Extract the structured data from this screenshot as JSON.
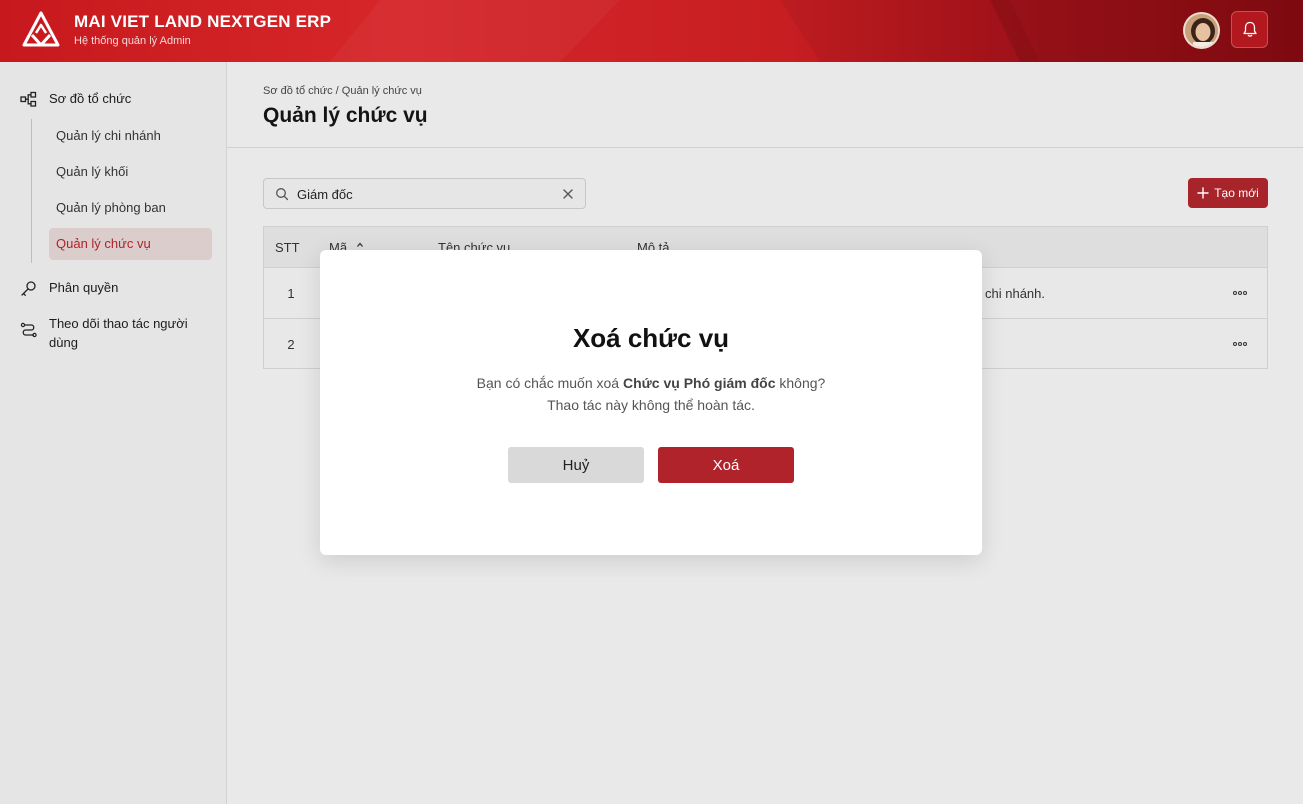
{
  "app": {
    "title": "MAI VIET LAND NEXTGEN ERP",
    "subtitle": "Hệ thống quản lý Admin"
  },
  "header": {
    "avatar_icon": "user-avatar",
    "notification_icon": "bell-icon"
  },
  "sidebar": {
    "groups": [
      {
        "label": "Sơ đồ tổ chức",
        "icon": "org-chart-icon"
      },
      {
        "label": "Phân quyền",
        "icon": "key-icon"
      },
      {
        "label": "Theo dõi thao tác người dùng",
        "icon": "route-icon"
      }
    ],
    "sub_items": [
      {
        "label": "Quản lý chi nhánh"
      },
      {
        "label": "Quản lý khối"
      },
      {
        "label": "Quản lý phòng ban"
      },
      {
        "label": "Quản lý chức vụ",
        "active": true
      }
    ]
  },
  "page": {
    "breadcrumb": "Sơ đồ tổ chức / Quản lý chức vụ",
    "title": "Quản lý chức vụ"
  },
  "search": {
    "value": "Giám đốc"
  },
  "toolbar": {
    "create_label": "Tạo mới"
  },
  "table": {
    "columns": [
      "STT",
      "Mã",
      "Tên chức vụ",
      "Mô tả"
    ],
    "rows": [
      {
        "stt": "1",
        "desc_visible": "chi nhánh."
      },
      {
        "stt": "2",
        "desc_visible": ""
      }
    ]
  },
  "modal": {
    "title": "Xoá chức vụ",
    "msg_prefix": "Bạn có chắc muốn xoá ",
    "msg_bold": "Chức vụ Phó giám đốc",
    "msg_suffix": " không?",
    "msg_line2": "Thao tác này không thể hoàn tác.",
    "cancel_label": "Huỷ",
    "delete_label": "Xoá"
  },
  "colors": {
    "brand_red": "#c7191d",
    "accent_button": "#a8242b",
    "active_nav_bg": "#dccdcd"
  }
}
